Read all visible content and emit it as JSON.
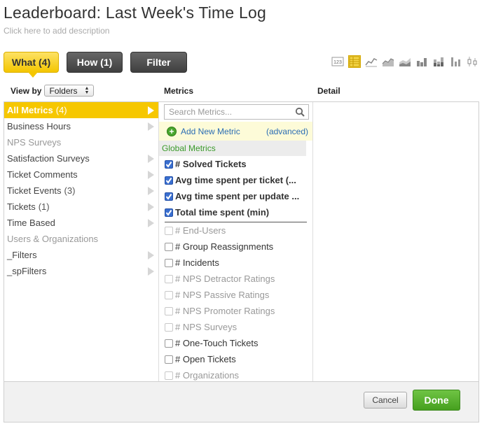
{
  "header": {
    "title": "Leaderboard: Last Week's Time Log",
    "description": "Click here to add description"
  },
  "tabs": [
    {
      "label": "What (4)",
      "active": true
    },
    {
      "label": "How (1)",
      "active": false
    },
    {
      "label": "Filter",
      "active": false
    }
  ],
  "viz_icons": [
    "number-icon",
    "table-icon",
    "line-chart-icon",
    "area-chart-icon",
    "stacked-area-icon",
    "bar-chart-icon",
    "stacked-bar-icon",
    "bar-line-icon",
    "whisker-icon"
  ],
  "columns": {
    "view_by_label": "View by",
    "view_by_value": "Folders",
    "metrics_label": "Metrics",
    "detail_label": "Detail"
  },
  "folders": [
    {
      "label": "All Metrics",
      "count": "(4)",
      "active": true,
      "dim": false,
      "chevron": true
    },
    {
      "label": "Business Hours",
      "count": "",
      "active": false,
      "dim": false,
      "chevron": true
    },
    {
      "label": "NPS Surveys",
      "count": "",
      "active": false,
      "dim": true,
      "chevron": false
    },
    {
      "label": "Satisfaction Surveys",
      "count": "",
      "active": false,
      "dim": false,
      "chevron": true
    },
    {
      "label": "Ticket Comments",
      "count": "",
      "active": false,
      "dim": false,
      "chevron": true
    },
    {
      "label": "Ticket Events",
      "count": "(3)",
      "active": false,
      "dim": false,
      "chevron": true
    },
    {
      "label": "Tickets",
      "count": "(1)",
      "active": false,
      "dim": false,
      "chevron": true
    },
    {
      "label": "Time Based",
      "count": "",
      "active": false,
      "dim": false,
      "chevron": true
    },
    {
      "label": "Users & Organizations",
      "count": "",
      "active": false,
      "dim": true,
      "chevron": false
    },
    {
      "label": "_Filters",
      "count": "",
      "active": false,
      "dim": false,
      "chevron": true
    },
    {
      "label": "_spFilters",
      "count": "",
      "active": false,
      "dim": false,
      "chevron": true
    }
  ],
  "search": {
    "placeholder": "Search Metrics..."
  },
  "add_metric": {
    "label": "Add New Metric",
    "advanced": "(advanced)"
  },
  "group_label": "Global Metrics",
  "selected_metrics": [
    "# Solved Tickets",
    "Avg time spent per ticket (...",
    "Avg time spent per update ...",
    "Total time spent (min)"
  ],
  "other_metrics": [
    {
      "label": "# End-Users",
      "dim": true
    },
    {
      "label": "# Group Reassignments",
      "dim": false
    },
    {
      "label": "# Incidents",
      "dim": false
    },
    {
      "label": "# NPS Detractor Ratings",
      "dim": true
    },
    {
      "label": "# NPS Passive Ratings",
      "dim": true
    },
    {
      "label": "# NPS Promoter Ratings",
      "dim": true
    },
    {
      "label": "# NPS Surveys",
      "dim": true
    },
    {
      "label": "# One-Touch Tickets",
      "dim": false
    },
    {
      "label": "# Open Tickets",
      "dim": false
    },
    {
      "label": "# Organizations",
      "dim": true
    }
  ],
  "footer": {
    "cancel": "Cancel",
    "done": "Done"
  },
  "colors": {
    "accent": "#f6c700",
    "done": "#46a01f",
    "link": "#2b6db4",
    "group": "#3a9a2a"
  }
}
